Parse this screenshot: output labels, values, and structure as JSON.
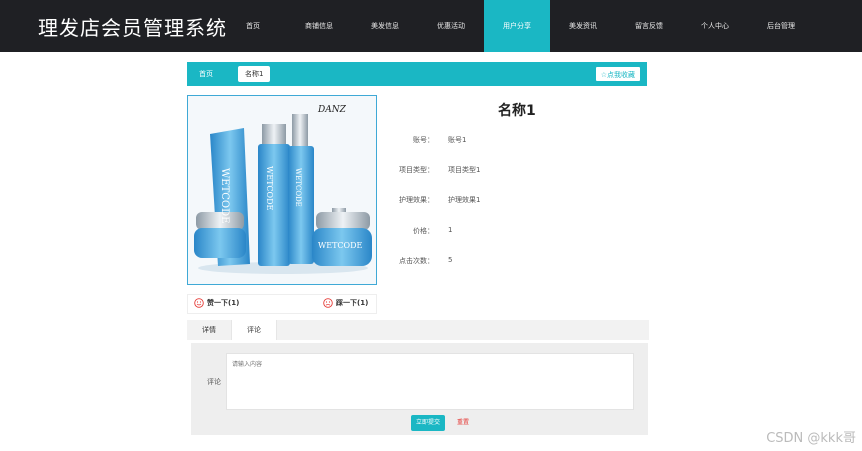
{
  "header": {
    "brand": "理发店会员管理系统",
    "nav": [
      "首页",
      "商铺信息",
      "美发信息",
      "优惠活动",
      "用户分享",
      "美发资讯",
      "留言反馈",
      "个人中心",
      "后台管理"
    ],
    "active_index": 4
  },
  "breadcrumb": {
    "home": "首页",
    "current": "名称1",
    "favorite": "☆点我收藏"
  },
  "product": {
    "brand_logo": "DANZ",
    "image_text": "WETCODE",
    "title": "名称1",
    "info": [
      {
        "label": "账号：",
        "value": "账号1"
      },
      {
        "label": "项目类型：",
        "value": "项目类型1"
      },
      {
        "label": "护理效果：",
        "value": "护理效果1"
      },
      {
        "label": "价格：",
        "value": "1"
      },
      {
        "label": "点击次数：",
        "value": "5"
      }
    ]
  },
  "votes": {
    "up": "赞一下(1)",
    "down": "踩一下(1)"
  },
  "tabs": [
    "详情",
    "评论"
  ],
  "active_tab": 1,
  "comment": {
    "label": "评论",
    "placeholder": "请输入内容",
    "submit": "立即提交",
    "reset": "重置"
  },
  "watermark": "CSDN @kkk哥",
  "colors": {
    "accent": "#1ab7c4",
    "topbar": "#1f2024",
    "danger": "#e53935"
  }
}
